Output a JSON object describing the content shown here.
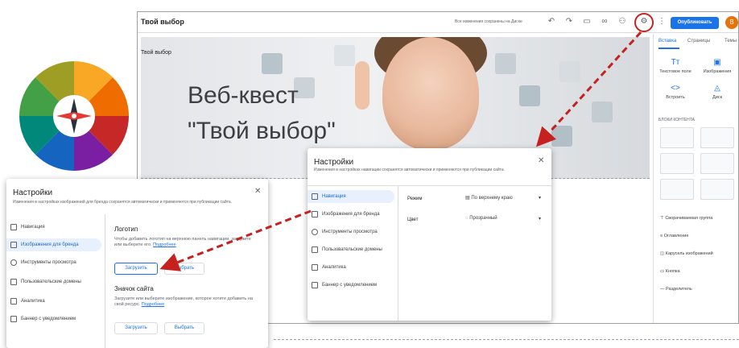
{
  "editor": {
    "site_title": "Твой выбор",
    "save_status": "Все изменения сохранены на Диске",
    "publish_label": "Опубликовать",
    "avatar_letter": "В"
  },
  "hero": {
    "small_title": "Твой выбор",
    "line1": "Веб-квест",
    "line2": "\"Твой выбор\""
  },
  "right_panel": {
    "tabs": [
      "Вставка",
      "Страницы",
      "Темы"
    ],
    "items": [
      {
        "icon": "Tт",
        "label": "Текстовое поле"
      },
      {
        "icon": "▣",
        "label": "Изображения"
      },
      {
        "icon": "<>",
        "label": "Встроить"
      },
      {
        "icon": "◬",
        "label": "Диск"
      }
    ],
    "blocks_heading": "БЛОКИ КОНТЕНТА",
    "rows": [
      "Сворачиваемая группа",
      "Оглавление",
      "Карусель изображений",
      "Кнопка",
      "Разделитель"
    ]
  },
  "dialog_center": {
    "title": "Настройки",
    "subtitle": "Изменения в настройках навигации сохранятся автоматически и применяются при публикации сайта",
    "nav": [
      "Навигация",
      "Изображения для бренда",
      "Инструменты просмотра",
      "Пользовательские домены",
      "Аналитика",
      "Баннер с уведомлением"
    ],
    "mode_label": "Режим",
    "mode_value": "По верхнему краю",
    "color_label": "Цвет",
    "color_value": "Прозрачный"
  },
  "dialog_left": {
    "title": "Настройки",
    "subtitle": "Изменения в настройках изображений для бренда сохранятся автоматически и применяются при публикации сайта.",
    "nav": [
      "Навигация",
      "Изображения для бренда",
      "Инструменты просмотра",
      "Пользовательские домены",
      "Аналитика",
      "Баннер с уведомлением"
    ],
    "logo_heading": "Логотип",
    "logo_text": "Чтобы добавить логотип на верхнюю панель навигации, загрузите или выберите его.",
    "logo_link": "Подробнее",
    "upload_label": "Загрузить",
    "choose_label": "Выбрать",
    "icon_heading": "Значок сайта",
    "icon_text": "Загрузите или выберите изображение, которое хотите добавить на свой ресурс.",
    "icon_link": "Подробнее",
    "upload2_label": "Загрузить",
    "choose2_label": "Выбрать"
  },
  "colors": {
    "accent": "#1a73e8",
    "arrow": "#c5221f"
  }
}
